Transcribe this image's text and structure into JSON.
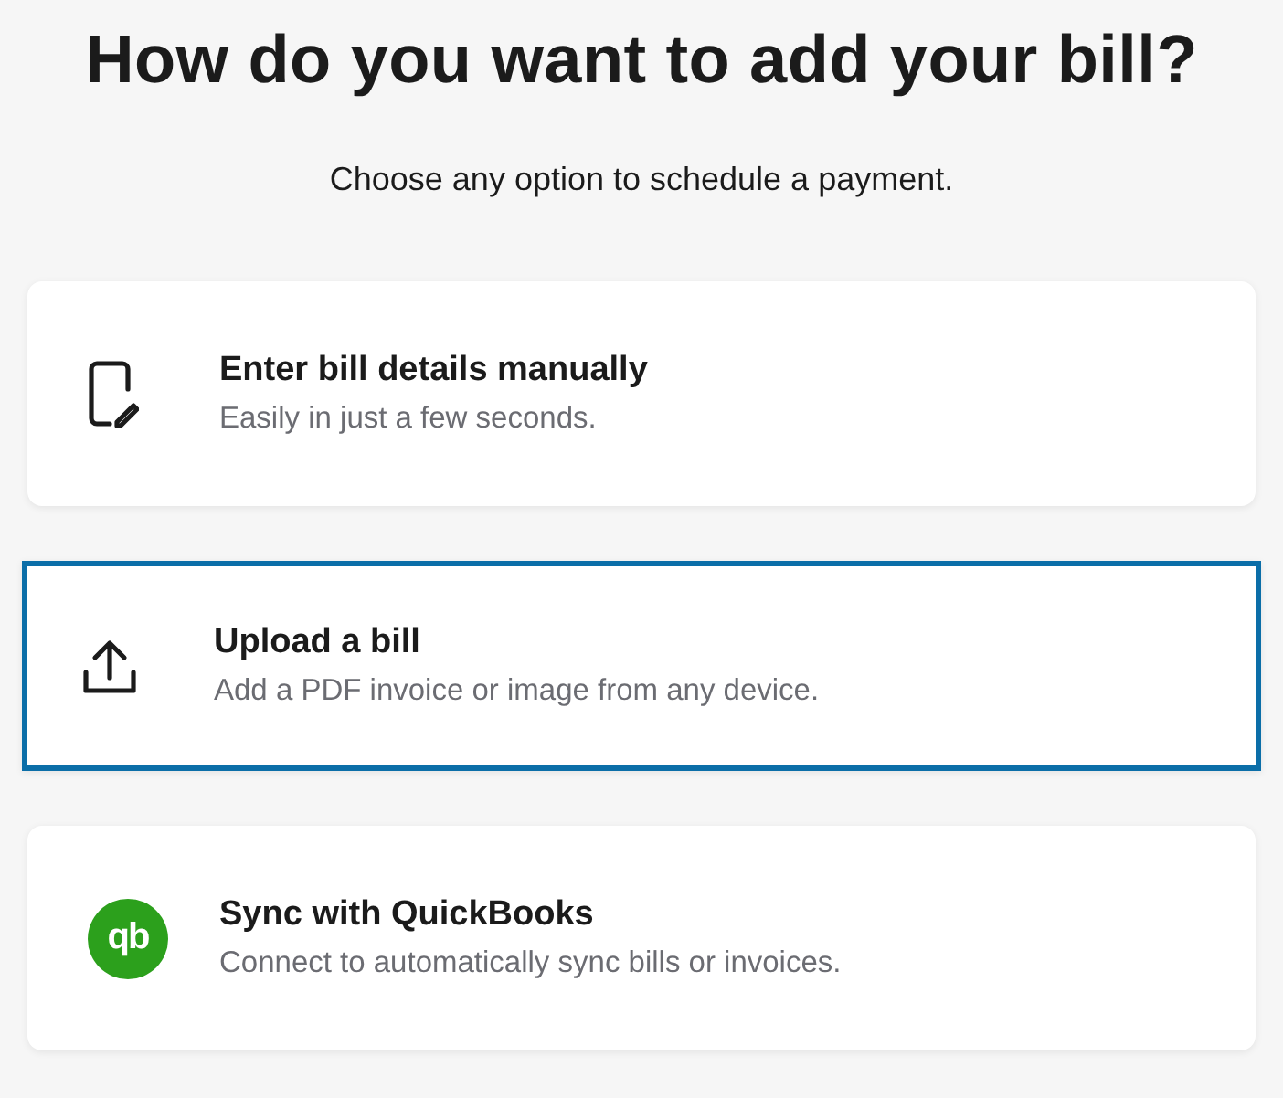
{
  "title": "How do you want to add your bill?",
  "subtitle": "Choose any option to schedule a payment.",
  "options": [
    {
      "kind": "manual",
      "title": "Enter bill details manually",
      "description": "Easily in just a few seconds.",
      "selected": false
    },
    {
      "kind": "upload",
      "title": "Upload a bill",
      "description": "Add a PDF invoice or image from any device.",
      "selected": true
    },
    {
      "kind": "quickbooks",
      "badge": "qb",
      "title": "Sync with QuickBooks",
      "description": "Connect to automatically sync bills or invoices.",
      "selected": false
    }
  ]
}
